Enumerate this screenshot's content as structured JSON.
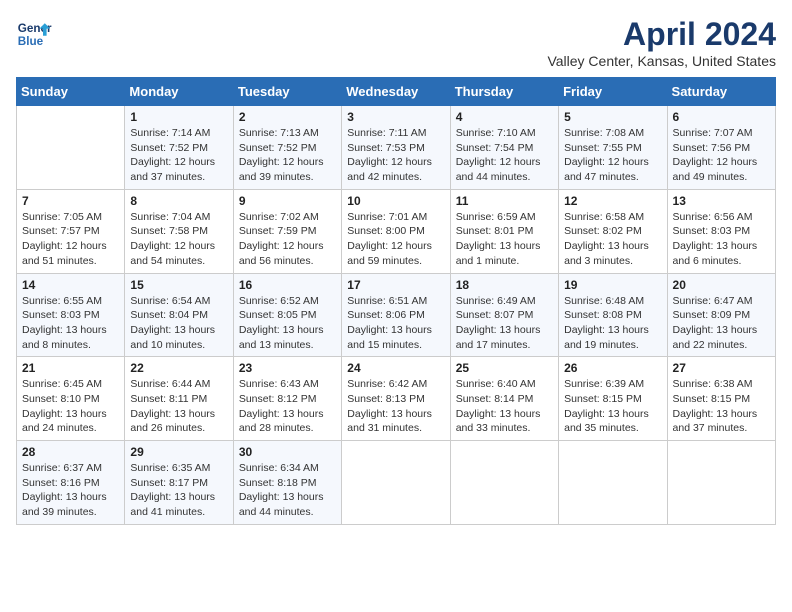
{
  "header": {
    "logo_line1": "General",
    "logo_line2": "Blue",
    "title": "April 2024",
    "subtitle": "Valley Center, Kansas, United States"
  },
  "days_of_week": [
    "Sunday",
    "Monday",
    "Tuesday",
    "Wednesday",
    "Thursday",
    "Friday",
    "Saturday"
  ],
  "weeks": [
    [
      {
        "day": "",
        "info": ""
      },
      {
        "day": "1",
        "info": "Sunrise: 7:14 AM\nSunset: 7:52 PM\nDaylight: 12 hours\nand 37 minutes."
      },
      {
        "day": "2",
        "info": "Sunrise: 7:13 AM\nSunset: 7:52 PM\nDaylight: 12 hours\nand 39 minutes."
      },
      {
        "day": "3",
        "info": "Sunrise: 7:11 AM\nSunset: 7:53 PM\nDaylight: 12 hours\nand 42 minutes."
      },
      {
        "day": "4",
        "info": "Sunrise: 7:10 AM\nSunset: 7:54 PM\nDaylight: 12 hours\nand 44 minutes."
      },
      {
        "day": "5",
        "info": "Sunrise: 7:08 AM\nSunset: 7:55 PM\nDaylight: 12 hours\nand 47 minutes."
      },
      {
        "day": "6",
        "info": "Sunrise: 7:07 AM\nSunset: 7:56 PM\nDaylight: 12 hours\nand 49 minutes."
      }
    ],
    [
      {
        "day": "7",
        "info": "Sunrise: 7:05 AM\nSunset: 7:57 PM\nDaylight: 12 hours\nand 51 minutes."
      },
      {
        "day": "8",
        "info": "Sunrise: 7:04 AM\nSunset: 7:58 PM\nDaylight: 12 hours\nand 54 minutes."
      },
      {
        "day": "9",
        "info": "Sunrise: 7:02 AM\nSunset: 7:59 PM\nDaylight: 12 hours\nand 56 minutes."
      },
      {
        "day": "10",
        "info": "Sunrise: 7:01 AM\nSunset: 8:00 PM\nDaylight: 12 hours\nand 59 minutes."
      },
      {
        "day": "11",
        "info": "Sunrise: 6:59 AM\nSunset: 8:01 PM\nDaylight: 13 hours\nand 1 minute."
      },
      {
        "day": "12",
        "info": "Sunrise: 6:58 AM\nSunset: 8:02 PM\nDaylight: 13 hours\nand 3 minutes."
      },
      {
        "day": "13",
        "info": "Sunrise: 6:56 AM\nSunset: 8:03 PM\nDaylight: 13 hours\nand 6 minutes."
      }
    ],
    [
      {
        "day": "14",
        "info": "Sunrise: 6:55 AM\nSunset: 8:03 PM\nDaylight: 13 hours\nand 8 minutes."
      },
      {
        "day": "15",
        "info": "Sunrise: 6:54 AM\nSunset: 8:04 PM\nDaylight: 13 hours\nand 10 minutes."
      },
      {
        "day": "16",
        "info": "Sunrise: 6:52 AM\nSunset: 8:05 PM\nDaylight: 13 hours\nand 13 minutes."
      },
      {
        "day": "17",
        "info": "Sunrise: 6:51 AM\nSunset: 8:06 PM\nDaylight: 13 hours\nand 15 minutes."
      },
      {
        "day": "18",
        "info": "Sunrise: 6:49 AM\nSunset: 8:07 PM\nDaylight: 13 hours\nand 17 minutes."
      },
      {
        "day": "19",
        "info": "Sunrise: 6:48 AM\nSunset: 8:08 PM\nDaylight: 13 hours\nand 19 minutes."
      },
      {
        "day": "20",
        "info": "Sunrise: 6:47 AM\nSunset: 8:09 PM\nDaylight: 13 hours\nand 22 minutes."
      }
    ],
    [
      {
        "day": "21",
        "info": "Sunrise: 6:45 AM\nSunset: 8:10 PM\nDaylight: 13 hours\nand 24 minutes."
      },
      {
        "day": "22",
        "info": "Sunrise: 6:44 AM\nSunset: 8:11 PM\nDaylight: 13 hours\nand 26 minutes."
      },
      {
        "day": "23",
        "info": "Sunrise: 6:43 AM\nSunset: 8:12 PM\nDaylight: 13 hours\nand 28 minutes."
      },
      {
        "day": "24",
        "info": "Sunrise: 6:42 AM\nSunset: 8:13 PM\nDaylight: 13 hours\nand 31 minutes."
      },
      {
        "day": "25",
        "info": "Sunrise: 6:40 AM\nSunset: 8:14 PM\nDaylight: 13 hours\nand 33 minutes."
      },
      {
        "day": "26",
        "info": "Sunrise: 6:39 AM\nSunset: 8:15 PM\nDaylight: 13 hours\nand 35 minutes."
      },
      {
        "day": "27",
        "info": "Sunrise: 6:38 AM\nSunset: 8:15 PM\nDaylight: 13 hours\nand 37 minutes."
      }
    ],
    [
      {
        "day": "28",
        "info": "Sunrise: 6:37 AM\nSunset: 8:16 PM\nDaylight: 13 hours\nand 39 minutes."
      },
      {
        "day": "29",
        "info": "Sunrise: 6:35 AM\nSunset: 8:17 PM\nDaylight: 13 hours\nand 41 minutes."
      },
      {
        "day": "30",
        "info": "Sunrise: 6:34 AM\nSunset: 8:18 PM\nDaylight: 13 hours\nand 44 minutes."
      },
      {
        "day": "",
        "info": ""
      },
      {
        "day": "",
        "info": ""
      },
      {
        "day": "",
        "info": ""
      },
      {
        "day": "",
        "info": ""
      }
    ]
  ]
}
